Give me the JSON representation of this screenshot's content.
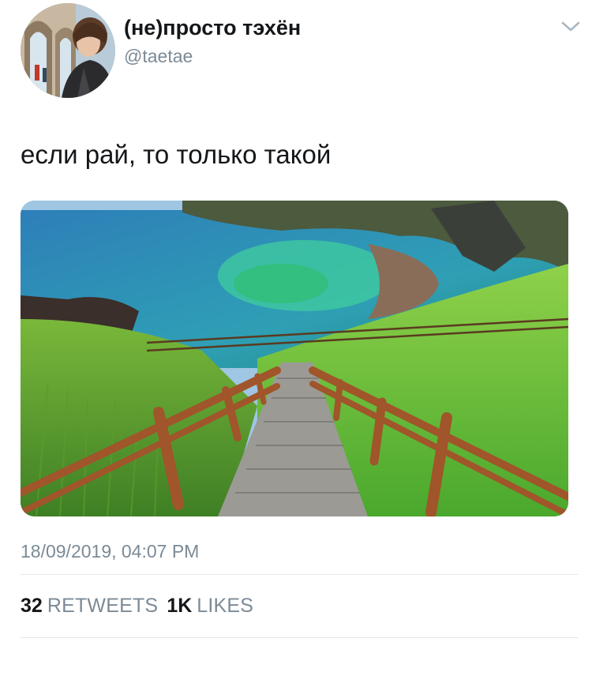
{
  "user": {
    "display_name": "(не)просто тэхён",
    "handle": "@taetae"
  },
  "tweet": {
    "text": "если рай, то только такой",
    "timestamp": "18/09/2019, 04:07 PM"
  },
  "stats": {
    "retweets": {
      "count": "32",
      "label": "RETWEETS"
    },
    "likes": {
      "count": "1K",
      "label": "LIKES"
    }
  },
  "icons": {
    "menu": "chevron-down-icon"
  },
  "colors": {
    "text": "#14171a",
    "secondary": "#7b8a96",
    "divider": "#e1e8ed"
  }
}
